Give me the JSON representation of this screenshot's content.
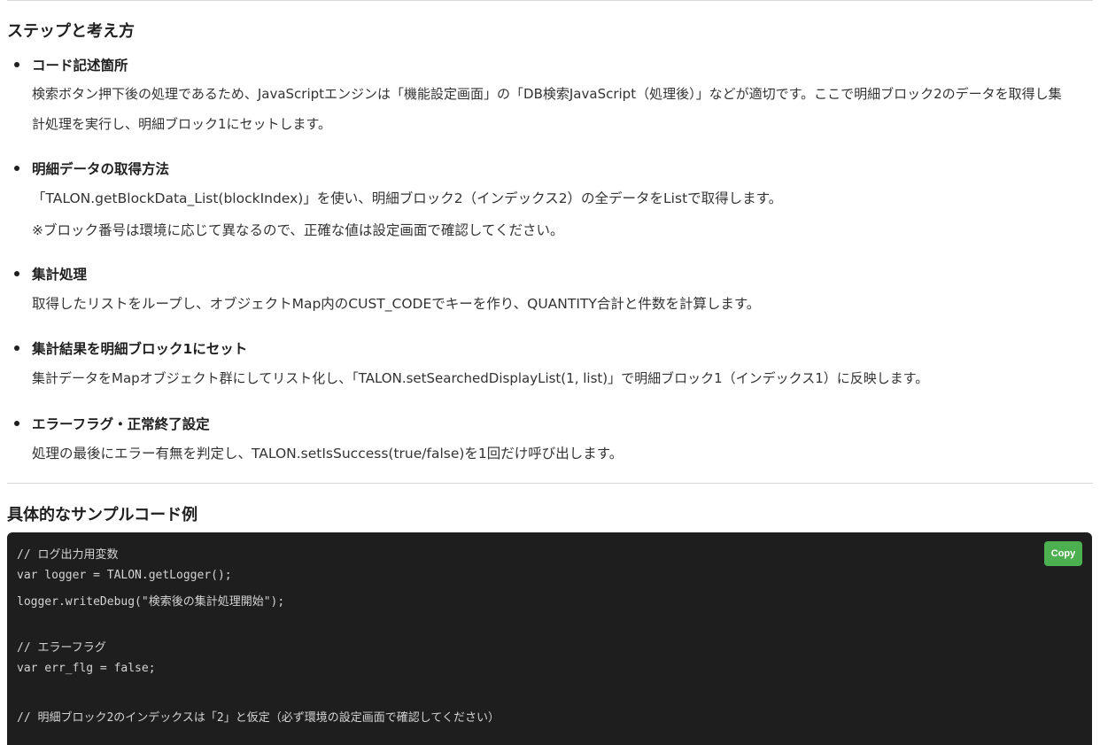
{
  "section1": {
    "title": "ステップと考え方",
    "items": [
      {
        "title": "コード記述箇所",
        "lines": [
          "検索ボタン押下後の処理であるため、JavaScriptエンジンは「機能設定画面」の「DB検索JavaScript（処理後）」などが適切です。ここで明細ブロック2のデータを取得し集",
          "計処理を実行し、明細ブロック1にセットします。"
        ]
      },
      {
        "title": "明細データの取得方法",
        "lines": [
          "「TALON.getBlockData_List(blockIndex)」を使い、明細ブロック2（インデックス2）の全データをListで取得します。",
          "※ブロック番号は環境に応じて異なるので、正確な値は設定画面で確認してください。"
        ]
      },
      {
        "title": "集計処理",
        "lines": [
          "取得したリストをループし、オブジェクトMap内のCUST_CODEでキーを作り、QUANTITY合計と件数を計算します。"
        ]
      },
      {
        "title": "集計結果を明細ブロック1にセット",
        "lines": [
          "集計データをMapオブジェクト群にしてリスト化し、「TALON.setSearchedDisplayList(1, list)」で明細ブロック1（インデックス1）に反映します。"
        ]
      },
      {
        "title": "エラーフラグ・正常終了設定",
        "lines": [
          "処理の最後にエラー有無を判定し、TALON.setIsSuccess(true/false)を1回だけ呼び出します。"
        ]
      }
    ]
  },
  "section2": {
    "title": "具体的なサンプルコード例"
  },
  "code": {
    "copy_label": "Copy",
    "lines": [
      "// ログ出力用変数",
      "var logger = TALON.getLogger();",
      "logger.writeDebug(\"検索後の集計処理開始\");",
      "",
      "// エラーフラグ",
      "var err_flg = false;",
      "",
      "// 明細ブロック2のインデックスは「2」と仮定（必ず環境の設定画面で確認してください）"
    ]
  }
}
